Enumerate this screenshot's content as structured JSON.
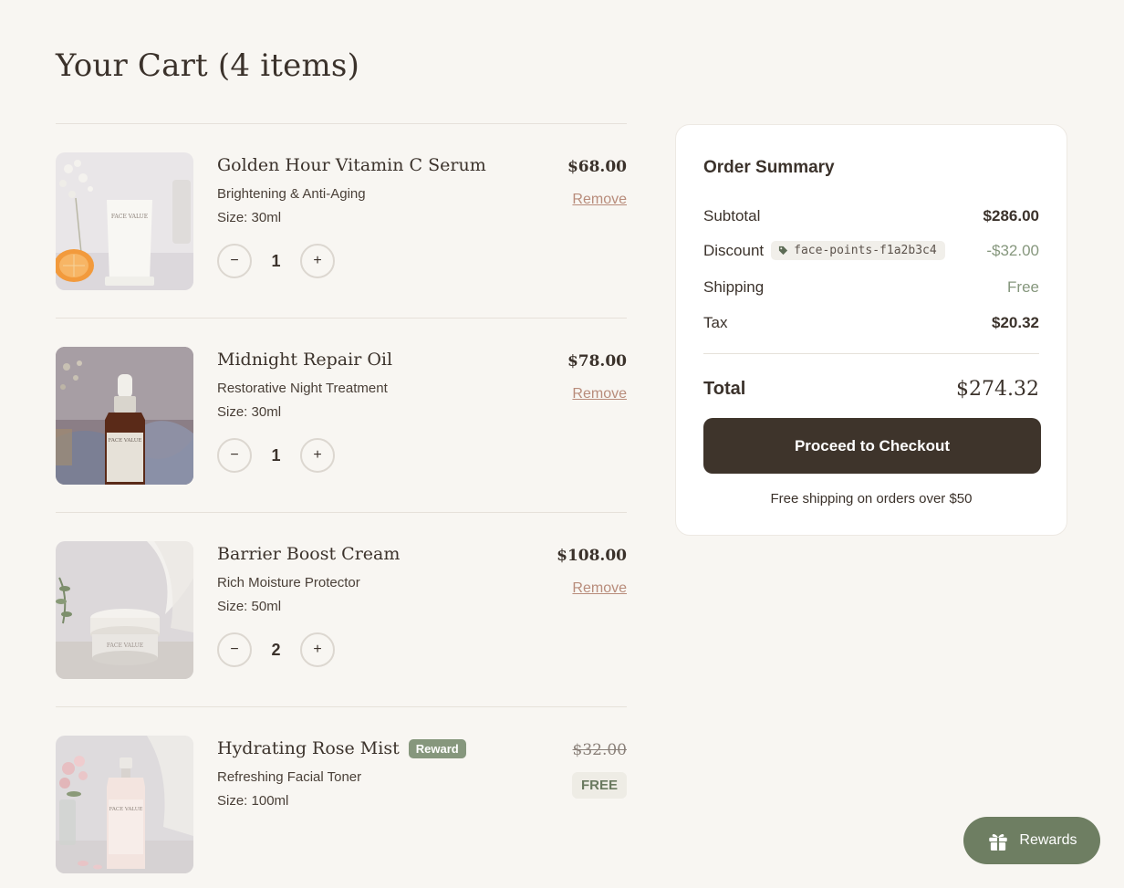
{
  "page": {
    "title": "Your Cart (4 items)"
  },
  "cart": {
    "items": [
      {
        "name": "Golden Hour Vitamin C Serum",
        "subtitle": "Brightening & Anti-Aging",
        "size": "Size: 30ml",
        "quantity": "1",
        "price": "$68.00",
        "remove_label": "Remove",
        "image_label": "FACE VALUE",
        "image_product": "Golden Hour Vitamin C Serum"
      },
      {
        "name": "Midnight Repair Oil",
        "subtitle": "Restorative Night Treatment",
        "size": "Size: 30ml",
        "quantity": "1",
        "price": "$78.00",
        "remove_label": "Remove",
        "image_label": "FACE VALUE",
        "image_product": "Midnight Renewal Oil"
      },
      {
        "name": "Barrier Boost Cream",
        "subtitle": "Rich Moisture Protector",
        "size": "Size: 50ml",
        "quantity": "2",
        "price": "$108.00",
        "remove_label": "Remove",
        "image_label": "FACE VALUE",
        "image_product": "Barrier Boost Cream"
      },
      {
        "name": "Hydrating Rose Mist",
        "badge": "Reward",
        "subtitle": "Refreshing Facial Toner",
        "size": "Size: 100ml",
        "price": "$32.00",
        "free_label": "FREE",
        "image_label": "FACE VALUE",
        "image_product": "Hydrating Rose Mist"
      }
    ],
    "decrement_symbol": "−",
    "increment_symbol": "+"
  },
  "summary": {
    "title": "Order Summary",
    "subtotal_label": "Subtotal",
    "subtotal_value": "$286.00",
    "discount_label": "Discount",
    "discount_code": "face-points-f1a2b3c4",
    "discount_value": "-$32.00",
    "shipping_label": "Shipping",
    "shipping_value": "Free",
    "tax_label": "Tax",
    "tax_value": "$20.32",
    "total_label": "Total",
    "total_value": "$274.32",
    "checkout_label": "Proceed to Checkout",
    "free_shipping_note": "Free shipping on orders over $50"
  },
  "rewards": {
    "label": "Rewards"
  },
  "colors": {
    "background": "#f8f6f2",
    "primary_dark": "#3e342b",
    "accent_green": "#86977d",
    "rewards_green": "#6e7e62",
    "remove_link": "#b88c7b"
  },
  "icons": {
    "discount_tag": "tag-icon",
    "rewards": "gift-icon"
  }
}
